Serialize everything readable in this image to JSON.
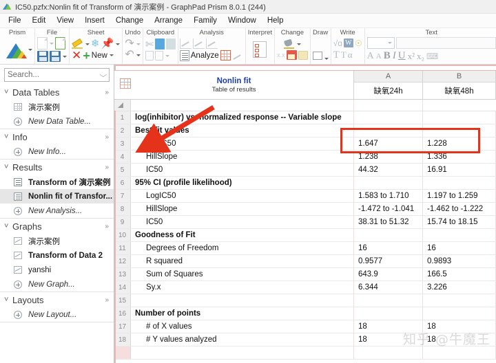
{
  "window": {
    "title": "IC50.pzfx:Nonlin fit of Transform of 演示案例 - GraphPad Prism 8.0.1 (244)",
    "logo_icon": "prism-logo-icon"
  },
  "menu": {
    "items": [
      "File",
      "Edit",
      "View",
      "Insert",
      "Change",
      "Arrange",
      "Family",
      "Window",
      "Help"
    ]
  },
  "ribbon": {
    "groups": [
      {
        "label": "Prism"
      },
      {
        "label": "File"
      },
      {
        "label": "Sheet"
      },
      {
        "label": "Undo"
      },
      {
        "label": "Clipboard"
      },
      {
        "label": "Analysis"
      },
      {
        "label": "Interpret"
      },
      {
        "label": "Change"
      },
      {
        "label": "Draw"
      },
      {
        "label": "Write"
      },
      {
        "label": "Text"
      }
    ],
    "new_label": "New",
    "analyze_label": "Analyze",
    "font_size_value": "",
    "font_name_value": ""
  },
  "sidebar": {
    "search": {
      "placeholder": "Search...",
      "value": ""
    },
    "sections": [
      {
        "title": "Data Tables",
        "items": [
          {
            "label": "演示案例",
            "icon": "table-icon",
            "style": "normal"
          },
          {
            "label": "New Data Table...",
            "icon": "plus-circle-icon",
            "style": "italic"
          }
        ]
      },
      {
        "title": "Info",
        "items": [
          {
            "label": "New Info...",
            "icon": "plus-circle-icon",
            "style": "italic"
          }
        ]
      },
      {
        "title": "Results",
        "items": [
          {
            "label": "Transform of 演示案例",
            "icon": "results-icon",
            "style": "bold"
          },
          {
            "label": "Nonlin fit of Transfor...",
            "icon": "results-icon",
            "style": "bold-selected"
          },
          {
            "label": "New Analysis...",
            "icon": "plus-circle-icon",
            "style": "italic"
          }
        ]
      },
      {
        "title": "Graphs",
        "items": [
          {
            "label": "演示案例",
            "icon": "graph-icon",
            "style": "normal"
          },
          {
            "label": "Transform of Data 2",
            "icon": "graph-icon",
            "style": "bold"
          },
          {
            "label": "yanshi",
            "icon": "graph-icon",
            "style": "normal"
          },
          {
            "label": "New Graph...",
            "icon": "plus-circle-icon",
            "style": "italic"
          }
        ]
      },
      {
        "title": "Layouts",
        "items": [
          {
            "label": "New Layout...",
            "icon": "plus-circle-icon",
            "style": "italic"
          }
        ]
      }
    ]
  },
  "sheet": {
    "title": "Nonlin fit",
    "subtitle": "Table of results",
    "columns": [
      {
        "letter": "A",
        "name": "缺氧24h"
      },
      {
        "letter": "B",
        "name": "缺氧48h"
      }
    ],
    "rows": [
      {
        "n": "1",
        "label": "log(inhibitor) vs. normalized response -- Variable slope",
        "bold": true,
        "indent": false,
        "a": "",
        "b": ""
      },
      {
        "n": "2",
        "label": "Best-fit values",
        "bold": true,
        "indent": false,
        "a": "",
        "b": ""
      },
      {
        "n": "3",
        "label": "LogIC50",
        "bold": false,
        "indent": true,
        "a": "1.647",
        "b": "1.228"
      },
      {
        "n": "4",
        "label": "HillSlope",
        "bold": false,
        "indent": true,
        "a": "1.238",
        "b": "1.336"
      },
      {
        "n": "5",
        "label": "IC50",
        "bold": false,
        "indent": true,
        "a": "44.32",
        "b": "16.91"
      },
      {
        "n": "6",
        "label": "95% CI (profile likelihood)",
        "bold": true,
        "indent": false,
        "a": "",
        "b": ""
      },
      {
        "n": "7",
        "label": "LogIC50",
        "bold": false,
        "indent": true,
        "a": "1.583 to 1.710",
        "b": "1.197 to 1.259"
      },
      {
        "n": "8",
        "label": "HillSlope",
        "bold": false,
        "indent": true,
        "a": "-1.472 to -1.041",
        "b": "-1.462 to -1.222"
      },
      {
        "n": "9",
        "label": "IC50",
        "bold": false,
        "indent": true,
        "a": "38.31 to 51.32",
        "b": "15.74 to 18.15"
      },
      {
        "n": "10",
        "label": "Goodness of Fit",
        "bold": true,
        "indent": false,
        "a": "",
        "b": ""
      },
      {
        "n": "11",
        "label": "Degrees of Freedom",
        "bold": false,
        "indent": true,
        "a": "16",
        "b": "16"
      },
      {
        "n": "12",
        "label": "R squared",
        "bold": false,
        "indent": true,
        "a": "0.9577",
        "b": "0.9893"
      },
      {
        "n": "13",
        "label": "Sum of Squares",
        "bold": false,
        "indent": true,
        "a": "643.9",
        "b": "166.5"
      },
      {
        "n": "14",
        "label": "Sy.x",
        "bold": false,
        "indent": true,
        "a": "6.344",
        "b": "3.226"
      },
      {
        "n": "15",
        "label": "",
        "bold": false,
        "indent": false,
        "a": "",
        "b": ""
      },
      {
        "n": "16",
        "label": "Number of points",
        "bold": true,
        "indent": false,
        "a": "",
        "b": ""
      },
      {
        "n": "17",
        "label": "# of X values",
        "bold": false,
        "indent": true,
        "a": "18",
        "b": "18"
      },
      {
        "n": "18",
        "label": "# Y values analyzed",
        "bold": false,
        "indent": true,
        "a": "18",
        "b": "18"
      }
    ]
  },
  "annotations": {
    "highlight_color": "#e5321b",
    "arrow_color": "#e5321b",
    "watermark": "知乎 @牛魔王"
  }
}
